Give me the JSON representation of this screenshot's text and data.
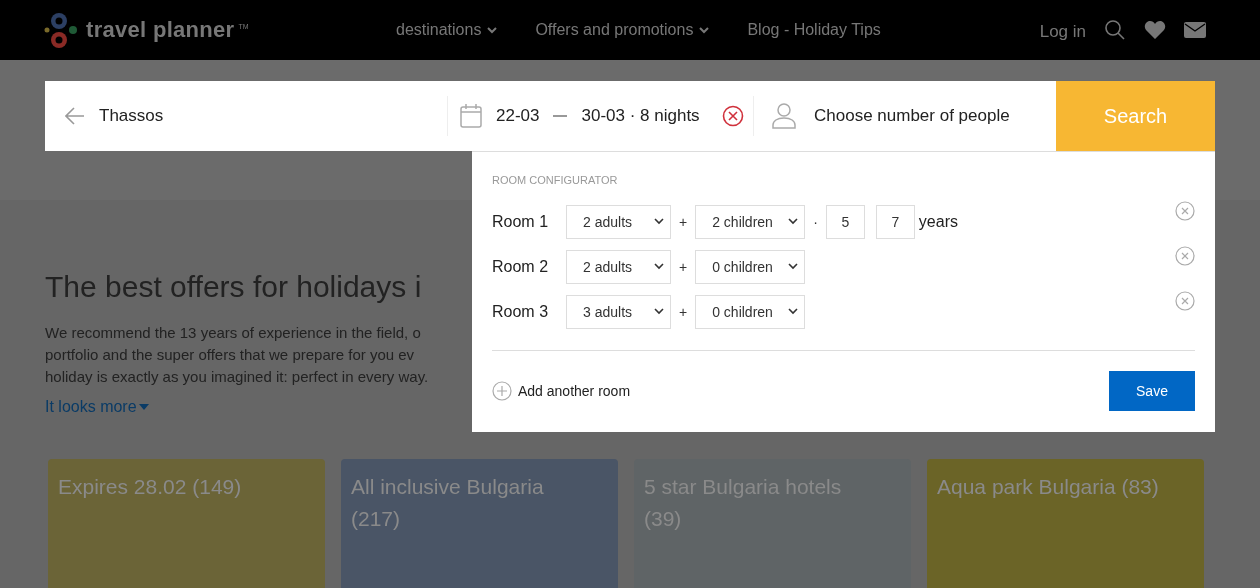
{
  "header": {
    "logo": "travel planner",
    "logo_mark": "TM",
    "nav": [
      {
        "label": "destinations",
        "dropdown": true
      },
      {
        "label": "Offers and promotions",
        "dropdown": true
      },
      {
        "label": "Blog - Holiday Tips",
        "dropdown": false
      }
    ],
    "login": "Log in"
  },
  "search": {
    "destination": "Thassos",
    "date_from": "22-03",
    "date_to": "30-03 · 8 nights",
    "people_placeholder": "Choose number of people",
    "button": "Search"
  },
  "configurator": {
    "title": "ROOM CONFIGURATOR",
    "rooms": [
      {
        "label": "Room 1",
        "adults": "2 adults",
        "plus": "+",
        "children": "2 children",
        "age_separator": "·",
        "ages": [
          "5",
          "7"
        ],
        "ages_unit": "years"
      },
      {
        "label": "Room 2",
        "adults": "2 adults",
        "plus": "+",
        "children": "0 children"
      },
      {
        "label": "Room 3",
        "adults": "3 adults",
        "plus": "+",
        "children": "0 children"
      }
    ],
    "add_room": "Add another room",
    "save": "Save"
  },
  "main": {
    "heading": "The best offers for holidays i",
    "paragraph_lines": [
      "We recommend the 13 years of experience in the field, o",
      "portfolio and the super offers that we prepare for you ev",
      "holiday is exactly as you imagined it: perfect in every way."
    ],
    "more_link": "It looks more"
  },
  "cards": [
    {
      "title": "Expires 28.02 (149)"
    },
    {
      "title": "All inclusive Bulgaria (217)"
    },
    {
      "title": "5 star Bulgaria hotels (39)"
    },
    {
      "title": "Aqua park Bulgaria (83)"
    }
  ]
}
